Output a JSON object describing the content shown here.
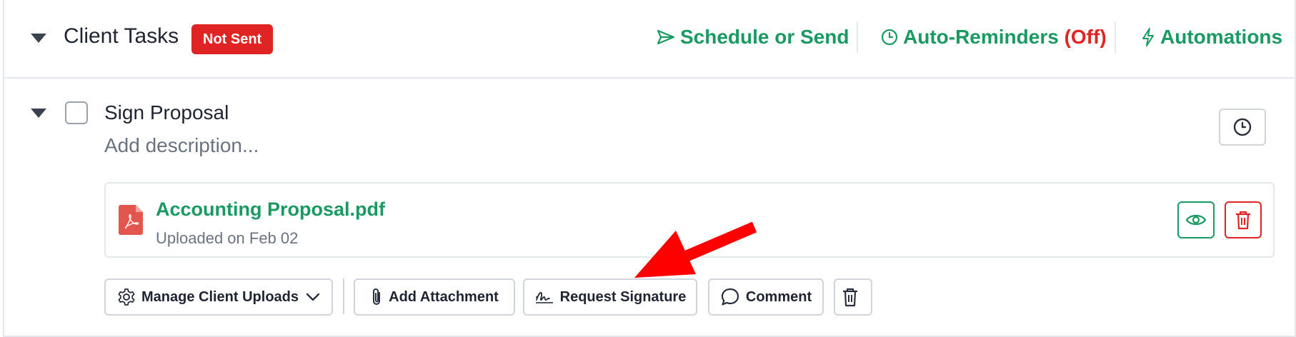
{
  "header": {
    "title": "Client Tasks",
    "status_badge": "Not Sent",
    "schedule_label": "Schedule or Send",
    "reminders_label": "Auto-Reminders",
    "reminders_state": "(Off)",
    "automations_label": "Automations"
  },
  "task": {
    "title": "Sign Proposal",
    "description_placeholder": "Add description...",
    "attachment": {
      "file_name": "Accounting Proposal.pdf",
      "meta": "Uploaded on Feb 02"
    },
    "actions": {
      "manage_uploads": "Manage Client Uploads",
      "add_attachment": "Add Attachment",
      "request_signature": "Request Signature",
      "comment": "Comment"
    }
  },
  "colors": {
    "accent_green": "#1a9a62",
    "danger_red": "#e02424",
    "annotation_arrow": "#ff0000"
  },
  "icons": [
    "caret-down-icon",
    "send-icon",
    "clock-icon",
    "lightning-icon",
    "pdf-file-icon",
    "eye-icon",
    "trash-icon",
    "gear-icon",
    "chevron-down-icon",
    "paperclip-icon",
    "signature-icon",
    "comment-icon"
  ]
}
